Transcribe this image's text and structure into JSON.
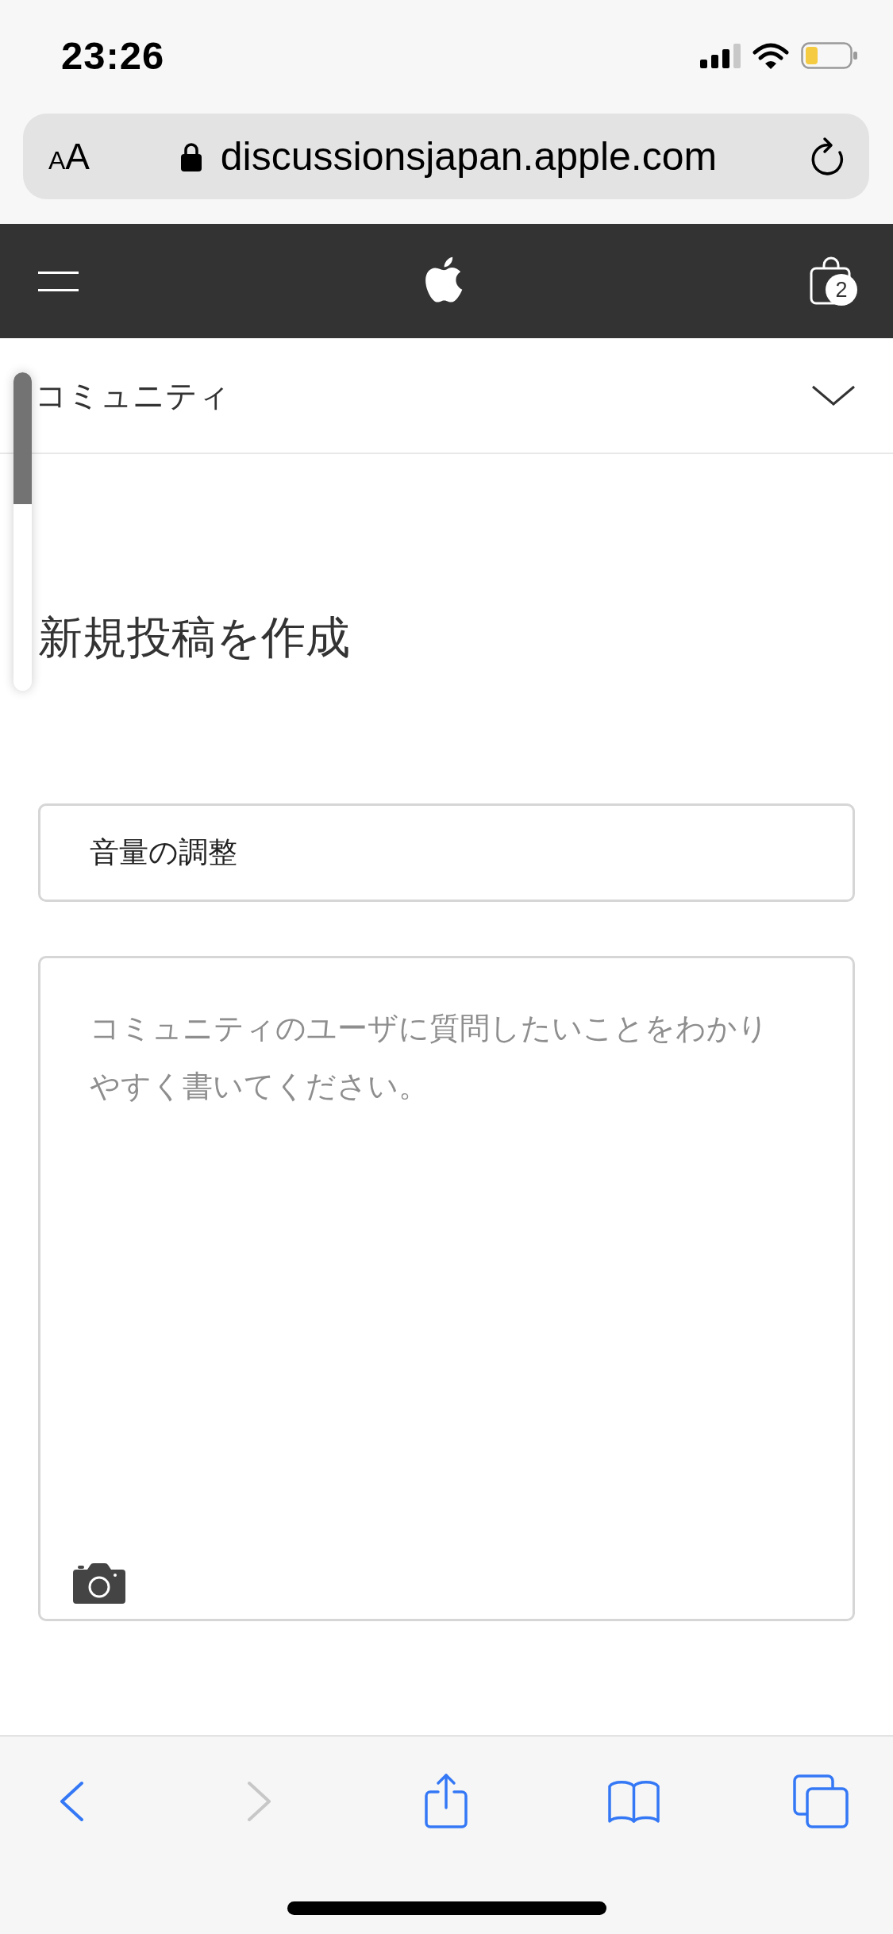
{
  "status_bar": {
    "time": "23:26"
  },
  "address_bar": {
    "text_size_button": {
      "small_letter": "A",
      "large_letter": "A"
    },
    "secure": true,
    "url": "discussionsjapan.apple.com"
  },
  "nav_bar": {
    "cart_count": "2"
  },
  "section_menu": {
    "label": "コミュニティ",
    "expanded": false
  },
  "page": {
    "title": "新規投稿を作成"
  },
  "form": {
    "subject": {
      "value": "音量の調整"
    },
    "body": {
      "placeholder": "コミュニティのユーザに質問したいことをわかりやすく書いてください。"
    }
  },
  "toolbar": {
    "buttons": [
      {
        "kind": "back",
        "disabled": false
      },
      {
        "kind": "forward",
        "disabled": true
      },
      {
        "kind": "share",
        "disabled": false
      },
      {
        "kind": "bookmarks",
        "disabled": false
      },
      {
        "kind": "tabs",
        "disabled": false
      }
    ]
  }
}
